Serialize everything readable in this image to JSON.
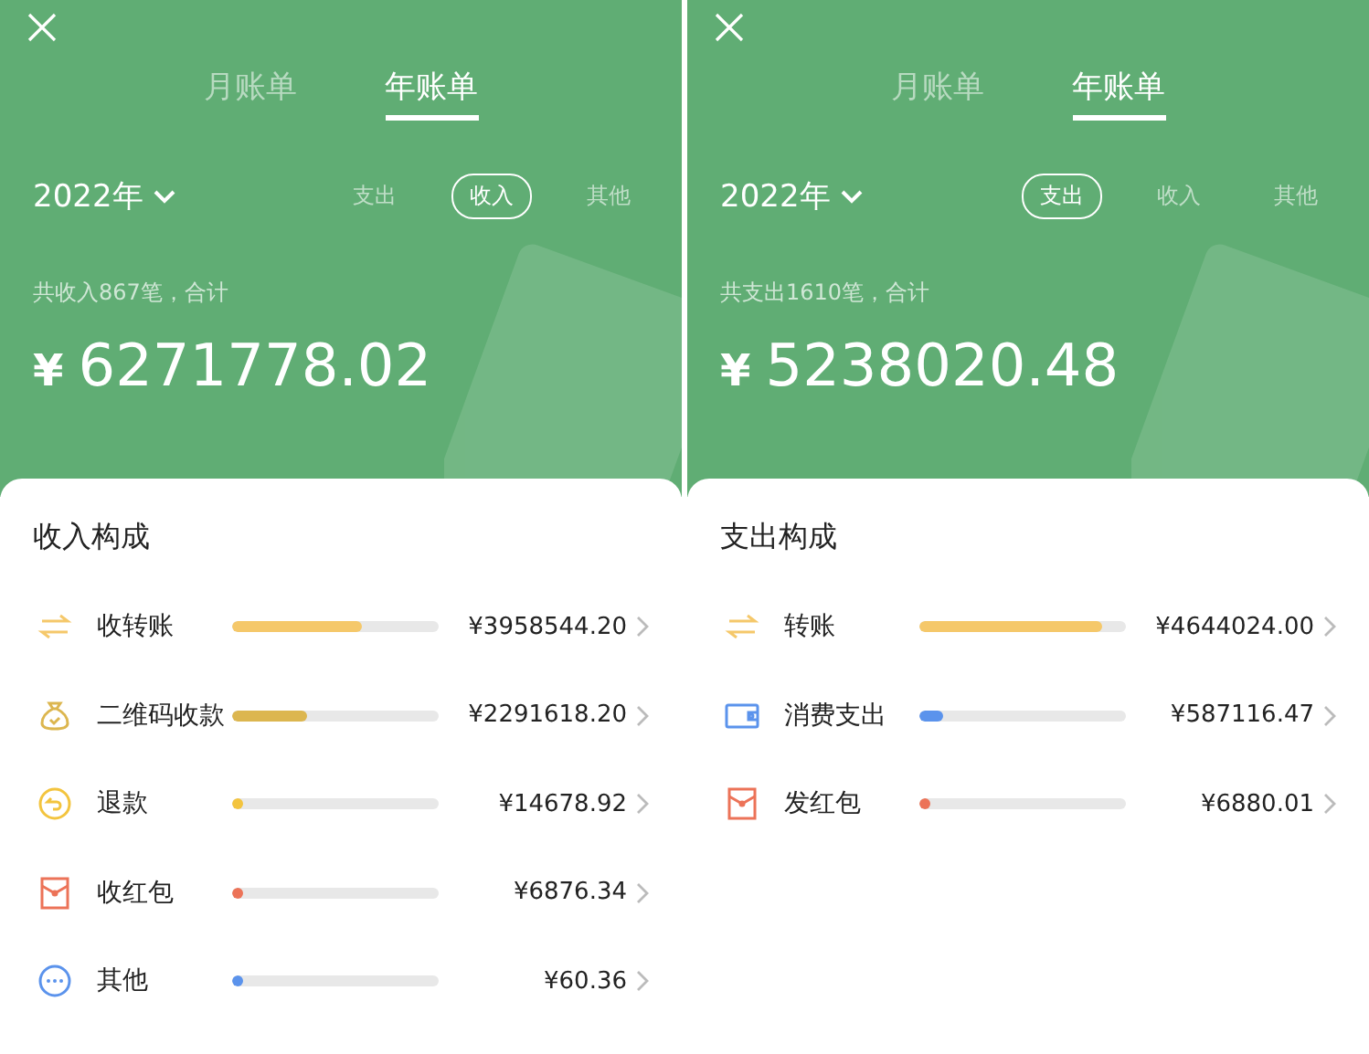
{
  "panels": [
    {
      "tabs": [
        {
          "label": "月账单",
          "selected": false
        },
        {
          "label": "年账单",
          "selected": true
        }
      ],
      "year": "2022年",
      "filters": [
        {
          "label": "支出",
          "selected": false
        },
        {
          "label": "收入",
          "selected": true
        },
        {
          "label": "其他",
          "selected": false
        }
      ],
      "summary": "共收入867笔，合计",
      "currency": "¥",
      "total": "6271778.02",
      "section_title": "收入构成",
      "rows": [
        {
          "kind": "transfer",
          "name": "收转账",
          "level": 0.631,
          "amount": "¥3958544.20",
          "color": "#f5c86a"
        },
        {
          "kind": "money-bag",
          "name": "二维码收款",
          "level": 0.365,
          "amount": "¥2291618.20",
          "color": "#dcb64f"
        },
        {
          "kind": "refund",
          "name": "退款",
          "level": 0.0023,
          "amount": "¥14678.92",
          "color": "#f3c43e"
        },
        {
          "kind": "red-packet",
          "name": "收红包",
          "level": 0.0011,
          "amount": "¥6876.34",
          "color": "#ec7358"
        },
        {
          "kind": "more",
          "name": "其他",
          "level": 1e-05,
          "amount": "¥60.36",
          "color": "#5b93ec"
        }
      ]
    },
    {
      "tabs": [
        {
          "label": "月账单",
          "selected": false
        },
        {
          "label": "年账单",
          "selected": true
        }
      ],
      "year": "2022年",
      "filters": [
        {
          "label": "支出",
          "selected": true
        },
        {
          "label": "收入",
          "selected": false
        },
        {
          "label": "其他",
          "selected": false
        }
      ],
      "summary": "共支出1610笔，合计",
      "currency": "¥",
      "total": "5238020.48",
      "section_title": "支出构成",
      "rows": [
        {
          "kind": "transfer",
          "name": "转账",
          "level": 0.887,
          "amount": "¥4644024.00",
          "color": "#f5c86a"
        },
        {
          "kind": "wallet",
          "name": "消费支出",
          "level": 0.112,
          "amount": "¥587116.47",
          "color": "#5b93ec"
        },
        {
          "kind": "red-packet",
          "name": "发红包",
          "level": 0.0013,
          "amount": "¥6880.01",
          "color": "#ec7358"
        }
      ]
    }
  ]
}
